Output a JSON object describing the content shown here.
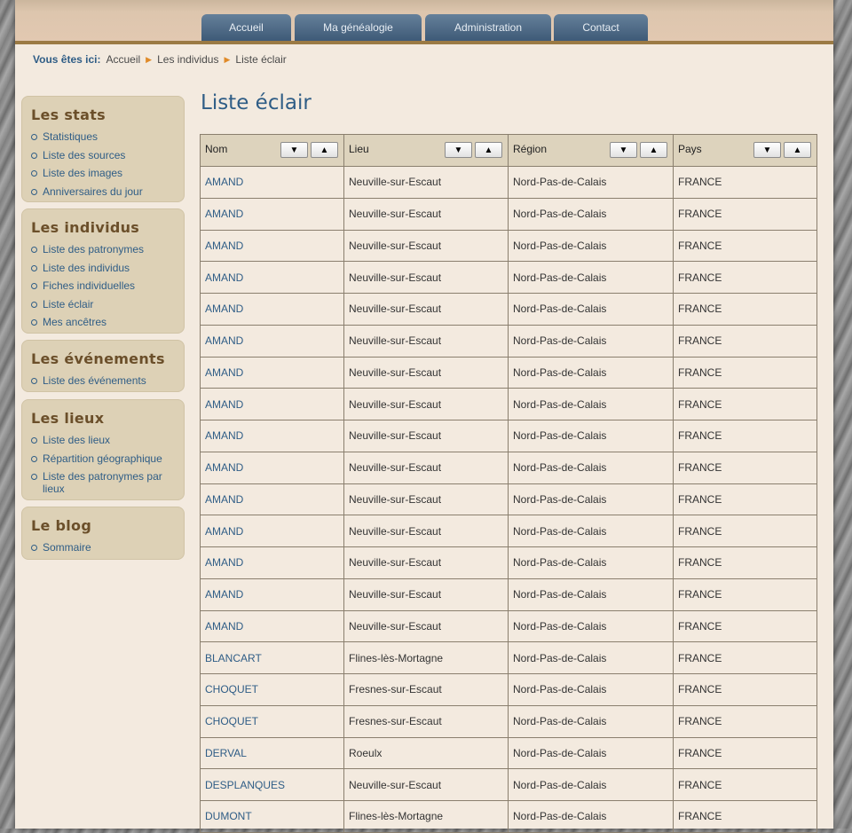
{
  "nav": {
    "tabs": [
      {
        "label": "Accueil"
      },
      {
        "label": "Ma généalogie"
      },
      {
        "label": "Administration"
      },
      {
        "label": "Contact"
      }
    ]
  },
  "breadcrumb": {
    "lead": "Vous êtes ici:",
    "items": [
      "Accueil",
      "Les individus",
      "Liste éclair"
    ]
  },
  "sidebar": {
    "blocks": [
      {
        "title": "Les stats",
        "items": [
          "Statistiques",
          "Liste des sources",
          "Liste des images",
          "Anniversaires du jour"
        ]
      },
      {
        "title": "Les individus",
        "items": [
          "Liste des patronymes",
          "Liste des individus",
          "Fiches individuelles",
          "Liste éclair",
          "Mes ancêtres"
        ]
      },
      {
        "title": "Les événements",
        "items": [
          "Liste des événements"
        ]
      },
      {
        "title": "Les lieux",
        "items": [
          "Liste des lieux",
          "Répartition géographique",
          "Liste des patronymes par lieux"
        ]
      },
      {
        "title": "Le blog",
        "items": [
          "Sommaire"
        ]
      }
    ]
  },
  "main": {
    "title": "Liste éclair",
    "columns": [
      {
        "label": "Nom",
        "sort_desc": "▼",
        "sort_asc": "▲"
      },
      {
        "label": "Lieu",
        "sort_desc": "▼",
        "sort_asc": "▲"
      },
      {
        "label": "Région",
        "sort_desc": "▼",
        "sort_asc": "▲"
      },
      {
        "label": "Pays",
        "sort_desc": "▼",
        "sort_asc": "▲"
      }
    ],
    "rows": [
      [
        "AMAND",
        "Neuville-sur-Escaut",
        "Nord-Pas-de-Calais",
        "FRANCE"
      ],
      [
        "AMAND",
        "Neuville-sur-Escaut",
        "Nord-Pas-de-Calais",
        "FRANCE"
      ],
      [
        "AMAND",
        "Neuville-sur-Escaut",
        "Nord-Pas-de-Calais",
        "FRANCE"
      ],
      [
        "AMAND",
        "Neuville-sur-Escaut",
        "Nord-Pas-de-Calais",
        "FRANCE"
      ],
      [
        "AMAND",
        "Neuville-sur-Escaut",
        "Nord-Pas-de-Calais",
        "FRANCE"
      ],
      [
        "AMAND",
        "Neuville-sur-Escaut",
        "Nord-Pas-de-Calais",
        "FRANCE"
      ],
      [
        "AMAND",
        "Neuville-sur-Escaut",
        "Nord-Pas-de-Calais",
        "FRANCE"
      ],
      [
        "AMAND",
        "Neuville-sur-Escaut",
        "Nord-Pas-de-Calais",
        "FRANCE"
      ],
      [
        "AMAND",
        "Neuville-sur-Escaut",
        "Nord-Pas-de-Calais",
        "FRANCE"
      ],
      [
        "AMAND",
        "Neuville-sur-Escaut",
        "Nord-Pas-de-Calais",
        "FRANCE"
      ],
      [
        "AMAND",
        "Neuville-sur-Escaut",
        "Nord-Pas-de-Calais",
        "FRANCE"
      ],
      [
        "AMAND",
        "Neuville-sur-Escaut",
        "Nord-Pas-de-Calais",
        "FRANCE"
      ],
      [
        "AMAND",
        "Neuville-sur-Escaut",
        "Nord-Pas-de-Calais",
        "FRANCE"
      ],
      [
        "AMAND",
        "Neuville-sur-Escaut",
        "Nord-Pas-de-Calais",
        "FRANCE"
      ],
      [
        "AMAND",
        "Neuville-sur-Escaut",
        "Nord-Pas-de-Calais",
        "FRANCE"
      ],
      [
        "BLANCART",
        "Flines-lès-Mortagne",
        "Nord-Pas-de-Calais",
        "FRANCE"
      ],
      [
        "CHOQUET",
        "Fresnes-sur-Escaut",
        "Nord-Pas-de-Calais",
        "FRANCE"
      ],
      [
        "CHOQUET",
        "Fresnes-sur-Escaut",
        "Nord-Pas-de-Calais",
        "FRANCE"
      ],
      [
        "DERVAL",
        "Roeulx",
        "Nord-Pas-de-Calais",
        "FRANCE"
      ],
      [
        "DESPLANQUES",
        "Neuville-sur-Escaut",
        "Nord-Pas-de-Calais",
        "FRANCE"
      ],
      [
        "DUMONT",
        "Flines-lès-Mortagne",
        "Nord-Pas-de-Calais",
        "FRANCE"
      ]
    ]
  }
}
